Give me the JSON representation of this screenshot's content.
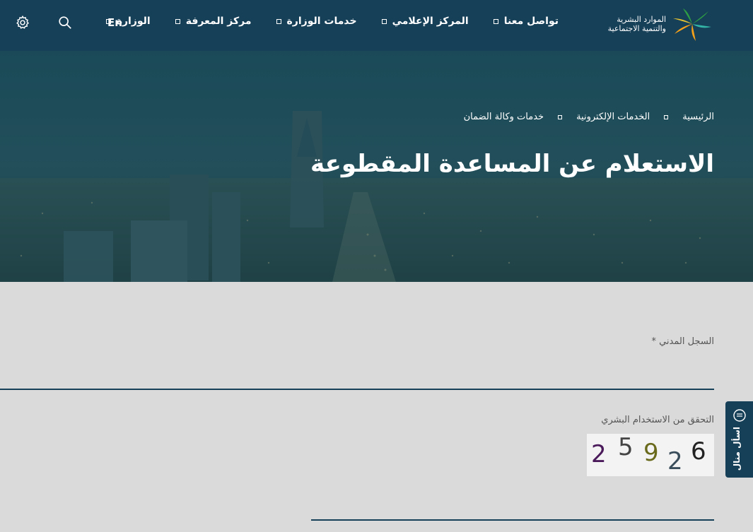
{
  "brand": {
    "line1": "الموارد البشرية",
    "line2": "والتنمية الاجتماعية"
  },
  "nav": {
    "items": [
      {
        "label": "الوزارة"
      },
      {
        "label": "مركز المعرفة"
      },
      {
        "label": "خدمات الوزارة"
      },
      {
        "label": "المركز الإعلامي"
      },
      {
        "label": "تواصل معنا"
      }
    ],
    "lang_label": "En",
    "icons": [
      "search-icon",
      "gear-icon"
    ]
  },
  "breadcrumb": [
    "الرئيسية",
    "الخدمات الإلكترونية",
    "خدمات وكالة الضمان"
  ],
  "page": {
    "title": "الاستعلام عن المساعدة المقطوعة"
  },
  "form": {
    "civil_record_label": "السجل المدني",
    "required_mark": "*",
    "captcha_label": "التحقق من الاستخدام البشري",
    "captcha_digits": [
      "2",
      "5",
      "9",
      "2",
      "6"
    ]
  },
  "side_tab": {
    "label": "اسأل منال"
  },
  "colors": {
    "nav_bg": "#163f58",
    "page_bg": "#dadada",
    "accent_green": "#2ea043",
    "accent_orange": "#f6a11a"
  }
}
